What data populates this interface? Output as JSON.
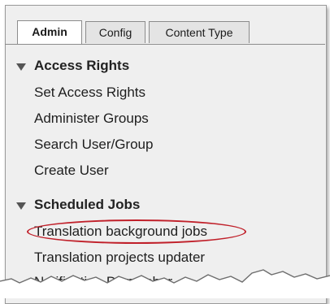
{
  "tabs": [
    {
      "label": "Admin",
      "active": true
    },
    {
      "label": "Config",
      "active": false
    },
    {
      "label": "Content Type",
      "active": false
    }
  ],
  "sections": [
    {
      "heading": "Access Rights",
      "items": [
        "Set Access Rights",
        "Administer Groups",
        "Search User/Group",
        "Create User"
      ]
    },
    {
      "heading": "Scheduled Jobs",
      "items": [
        "Translation background jobs",
        "Translation projects updater",
        "Notification Dispatcher"
      ]
    }
  ],
  "highlight": {
    "item": "Translation background jobs",
    "color": "#c0202a"
  },
  "colors": {
    "panel": "#efefef",
    "tab_active": "#ffffff",
    "tab_inactive": "#e4e4e4",
    "border": "#8c8c8c"
  }
}
